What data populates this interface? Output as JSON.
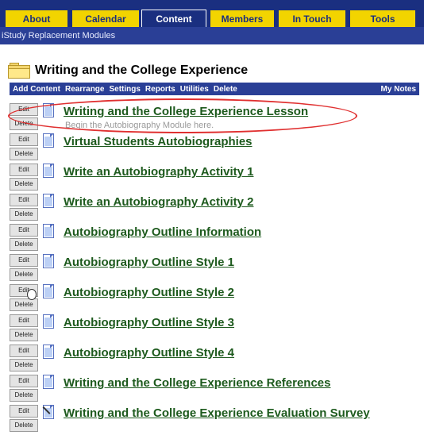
{
  "nav": {
    "tabs": [
      "About",
      "Calendar",
      "Content",
      "Members",
      "In Touch",
      "Tools"
    ],
    "active": "Content"
  },
  "subbar": {
    "text": "iStudy Replacement Modules"
  },
  "page": {
    "title": "Writing and the College Experience"
  },
  "actions": {
    "add_content": "Add Content",
    "rearrange": "Rearrange",
    "settings": "Settings",
    "reports": "Reports",
    "utilities": "Utilities",
    "delete": "Delete",
    "my_notes": "My Notes"
  },
  "item_buttons": {
    "edit": "Edit",
    "delete": "Delete"
  },
  "items": [
    {
      "title": "Writing and the College Experience Lesson",
      "description": "Begin the Autobiography Module here.",
      "icon": "document-icon"
    },
    {
      "title": "Virtual Students Autobiographies",
      "icon": "document-icon"
    },
    {
      "title": "Write an Autobiography Activity 1",
      "icon": "document-icon"
    },
    {
      "title": "Write an Autobiography Activity 2",
      "icon": "document-icon"
    },
    {
      "title": "Autobiography Outline Information",
      "icon": "document-icon"
    },
    {
      "title": "Autobiography Outline Style 1",
      "icon": "document-icon"
    },
    {
      "title": "Autobiography Outline Style 2",
      "icon": "document-icon"
    },
    {
      "title": "Autobiography Outline Style 3",
      "icon": "document-icon"
    },
    {
      "title": "Autobiography Outline Style 4",
      "icon": "document-icon"
    },
    {
      "title": "Writing and the College Experience References",
      "icon": "document-icon"
    },
    {
      "title": "Writing and the College Experience Evaluation Survey",
      "icon": "survey-icon"
    }
  ]
}
